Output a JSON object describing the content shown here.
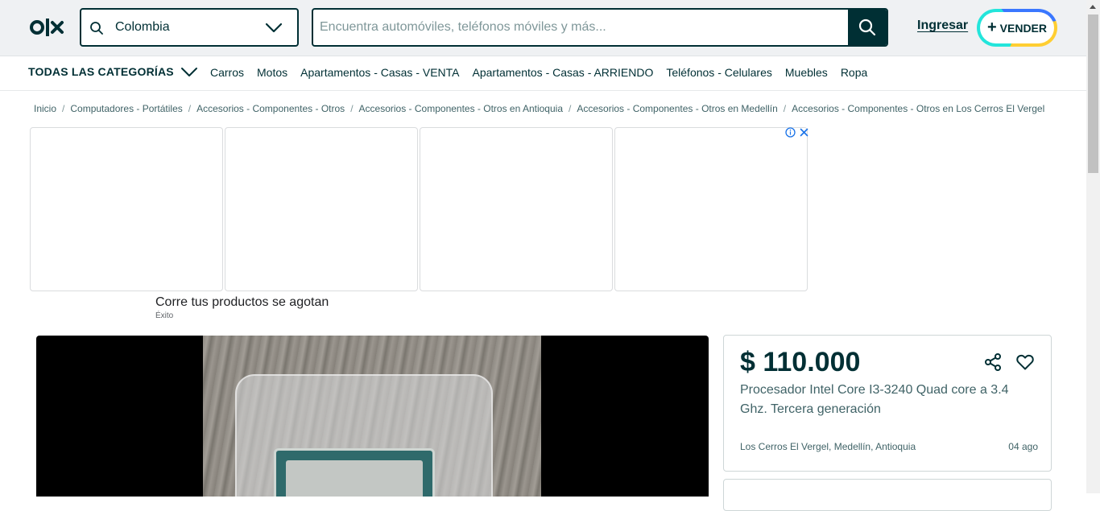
{
  "header": {
    "logo_text": "OLX",
    "location": "Colombia",
    "search_placeholder": "Encuentra automóviles, teléfonos móviles y más...",
    "login_label": "Ingresar",
    "sell_label": "VENDER",
    "sell_plus": "+"
  },
  "categories": {
    "all_label": "TODAS LAS CATEGORÍAS",
    "items": [
      "Carros",
      "Motos",
      "Apartamentos - Casas - VENTA",
      "Apartamentos - Casas - ARRIENDO",
      "Teléfonos - Celulares",
      "Muebles",
      "Ropa"
    ]
  },
  "breadcrumb": {
    "items": [
      "Inicio",
      "Computadores - Portátiles",
      "Accesorios - Componentes - Otros",
      "Accesorios - Componentes - Otros en Antioquia",
      "Accesorios - Componentes - Otros en Medellín",
      "Accesorios - Componentes - Otros en Los Cerros El Vergel"
    ],
    "separator": "/"
  },
  "ad": {
    "title": "Corre tus productos se agotan",
    "source": "Éxito",
    "info_icon": "info-icon",
    "close_icon": "close-icon"
  },
  "listing": {
    "price": "$ 110.000",
    "title": "Procesador Intel Core I3-3240 Quad core a 3.4 Ghz. Tercera generación",
    "location": "Los Cerros El Vergel, Medellín, Antioquia",
    "date": "04 ago"
  },
  "colors": {
    "brand_dark": "#002f34",
    "header_bg": "#eff1f3",
    "text_muted": "#406367"
  }
}
